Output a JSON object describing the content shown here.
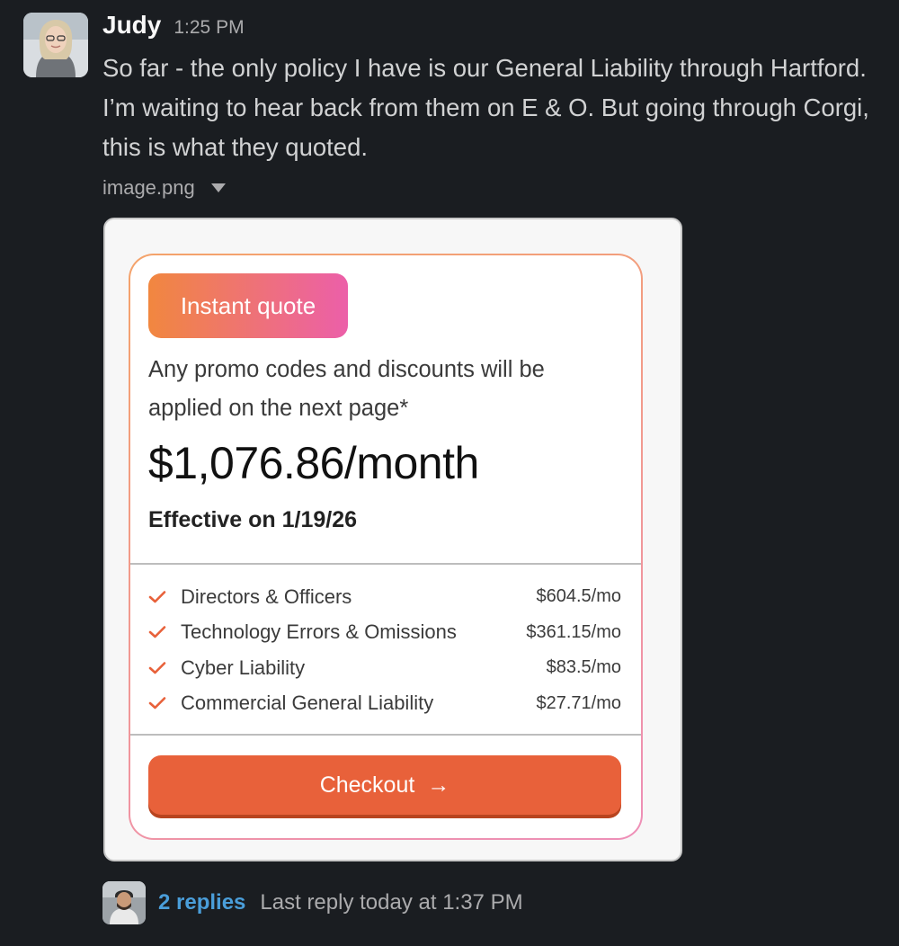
{
  "message": {
    "author": "Judy",
    "time": "1:25 PM",
    "text": "So far - the only policy I have is our General Liability through Hartford. I’m waiting to hear back from them on E & O.  But going through Corgi, this is what they quoted."
  },
  "attachment": {
    "filename": "image.png",
    "quote": {
      "badge": "Instant quote",
      "promo_text": "Any promo codes and discounts will be applied on the next page*",
      "price": "$1,076.86/month",
      "effective": "Effective on 1/19/26",
      "coverages": [
        {
          "name": "Directors & Officers",
          "price": "$604.5/mo"
        },
        {
          "name": "Technology Errors & Omissions",
          "price": "$361.15/mo"
        },
        {
          "name": "Cyber Liability",
          "price": "$83.5/mo"
        },
        {
          "name": "Commercial General Liability",
          "price": "$27.71/mo"
        }
      ],
      "checkout_label": "Checkout",
      "checkout_arrow": "→"
    }
  },
  "thread": {
    "replies_label": "2 replies",
    "last_reply": "Last reply today at 1:37 PM"
  },
  "colors": {
    "background": "#1a1d21",
    "link": "#4a9eda",
    "checkout": "#e8613a",
    "check": "#e8613a"
  },
  "icons": {
    "check": "check-icon",
    "dropdown": "caret-down-icon",
    "arrow": "arrow-right-icon"
  }
}
